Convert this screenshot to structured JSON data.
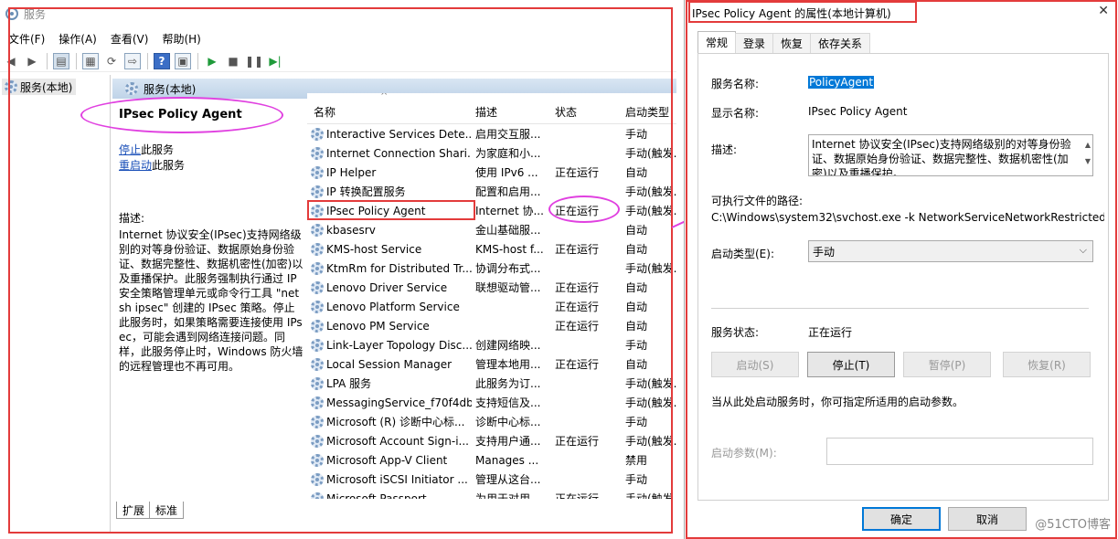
{
  "services_window": {
    "title": "服务",
    "menu": [
      "文件(F)",
      "操作(A)",
      "查看(V)",
      "帮助(H)"
    ],
    "tree_item": "服务(本地)",
    "content_header": "服务(本地)",
    "selected_service_title": "IPsec Policy Agent",
    "stop_link": "停止",
    "stop_link_suffix": "此服务",
    "restart_link": "重启动",
    "restart_link_suffix": "此服务",
    "description_label": "描述:",
    "description_text": "Internet 协议安全(IPsec)支持网络级别的对等身份验证、数据原始身份验证、数据完整性、数据机密性(加密)以及重播保护。此服务强制执行通过 IP 安全策略管理单元或命令行工具 \"netsh ipsec\" 创建的 IPsec 策略。停止此服务时，如果策略需要连接使用 IPsec，可能会遇到网络连接问题。同样，此服务停止时，Windows 防火墙的远程管理也不再可用。",
    "columns": {
      "name": "名称",
      "description": "描述",
      "status": "状态",
      "startup": "启动类型"
    },
    "rows": [
      {
        "name": "Interactive Services Dete...",
        "desc": "启用交互服...",
        "status": "",
        "startup": "手动"
      },
      {
        "name": "Internet Connection Shari...",
        "desc": "为家庭和小...",
        "status": "",
        "startup": "手动(触发..."
      },
      {
        "name": "IP Helper",
        "desc": "使用 IPv6 ...",
        "status": "正在运行",
        "startup": "自动"
      },
      {
        "name": "IP 转换配置服务",
        "desc": "配置和启用...",
        "status": "",
        "startup": "手动(触发..."
      },
      {
        "name": "IPsec Policy Agent",
        "desc": "Internet 协...",
        "status": "正在运行",
        "startup": "手动(触发..."
      },
      {
        "name": "kbasesrv",
        "desc": "金山基础服...",
        "status": "",
        "startup": "自动"
      },
      {
        "name": "KMS-host Service",
        "desc": "KMS-host f...",
        "status": "正在运行",
        "startup": "自动"
      },
      {
        "name": "KtmRm for Distributed Tr...",
        "desc": "协调分布式...",
        "status": "",
        "startup": "手动(触发..."
      },
      {
        "name": "Lenovo Driver Service",
        "desc": "联想驱动管...",
        "status": "正在运行",
        "startup": "自动"
      },
      {
        "name": "Lenovo Platform Service",
        "desc": "",
        "status": "正在运行",
        "startup": "自动"
      },
      {
        "name": "Lenovo PM Service",
        "desc": "",
        "status": "正在运行",
        "startup": "自动"
      },
      {
        "name": "Link-Layer Topology Disc...",
        "desc": "创建网络映...",
        "status": "",
        "startup": "手动"
      },
      {
        "name": "Local Session Manager",
        "desc": "管理本地用...",
        "status": "正在运行",
        "startup": "自动"
      },
      {
        "name": "LPA 服务",
        "desc": "此服务为订...",
        "status": "",
        "startup": "手动(触发..."
      },
      {
        "name": "MessagingService_f70f4db",
        "desc": "支持短信及...",
        "status": "",
        "startup": "手动(触发..."
      },
      {
        "name": "Microsoft (R) 诊断中心标...",
        "desc": "诊断中心标...",
        "status": "",
        "startup": "手动"
      },
      {
        "name": "Microsoft Account Sign-i...",
        "desc": "支持用户通...",
        "status": "正在运行",
        "startup": "手动(触发..."
      },
      {
        "name": "Microsoft App-V Client",
        "desc": "Manages ...",
        "status": "",
        "startup": "禁用"
      },
      {
        "name": "Microsoft iSCSI Initiator ...",
        "desc": "管理从这台...",
        "status": "",
        "startup": "手动"
      },
      {
        "name": "Microsoft Passport",
        "desc": "为用于对用...",
        "status": "正在运行",
        "startup": "手动(触发..."
      }
    ],
    "bottom_tabs": [
      "扩展",
      "标准"
    ]
  },
  "dialog": {
    "title": "IPsec Policy Agent 的属性(本地计算机)",
    "tabs": [
      "常规",
      "登录",
      "恢复",
      "依存关系"
    ],
    "service_name_label": "服务名称:",
    "service_name": "PolicyAgent",
    "display_name_label": "显示名称:",
    "display_name": "IPsec Policy Agent",
    "description_label": "描述:",
    "description": "Internet 协议安全(IPsec)支持网络级别的对等身份验证、数据原始身份验证、数据完整性、数据机密性(加密)以及重播保护。",
    "exe_path_label": "可执行文件的路径:",
    "exe_path": "C:\\Windows\\system32\\svchost.exe -k NetworkServiceNetworkRestricted",
    "startup_type_label": "启动类型(E):",
    "startup_type": "手动",
    "status_label": "服务状态:",
    "status": "正在运行",
    "buttons": {
      "start": "启动(S)",
      "stop": "停止(T)",
      "pause": "暂停(P)",
      "resume": "恢复(R)"
    },
    "hint": "当从此处启动服务时，你可指定所适用的启动参数。",
    "params_label": "启动参数(M):",
    "params_value": "",
    "ok": "确定",
    "cancel": "取消"
  },
  "watermark": "@51CTO博客",
  "colors": {
    "annotation_red": "#e33b3b",
    "annotation_magenta": "#e040e0",
    "selection_blue": "#0078d7"
  }
}
